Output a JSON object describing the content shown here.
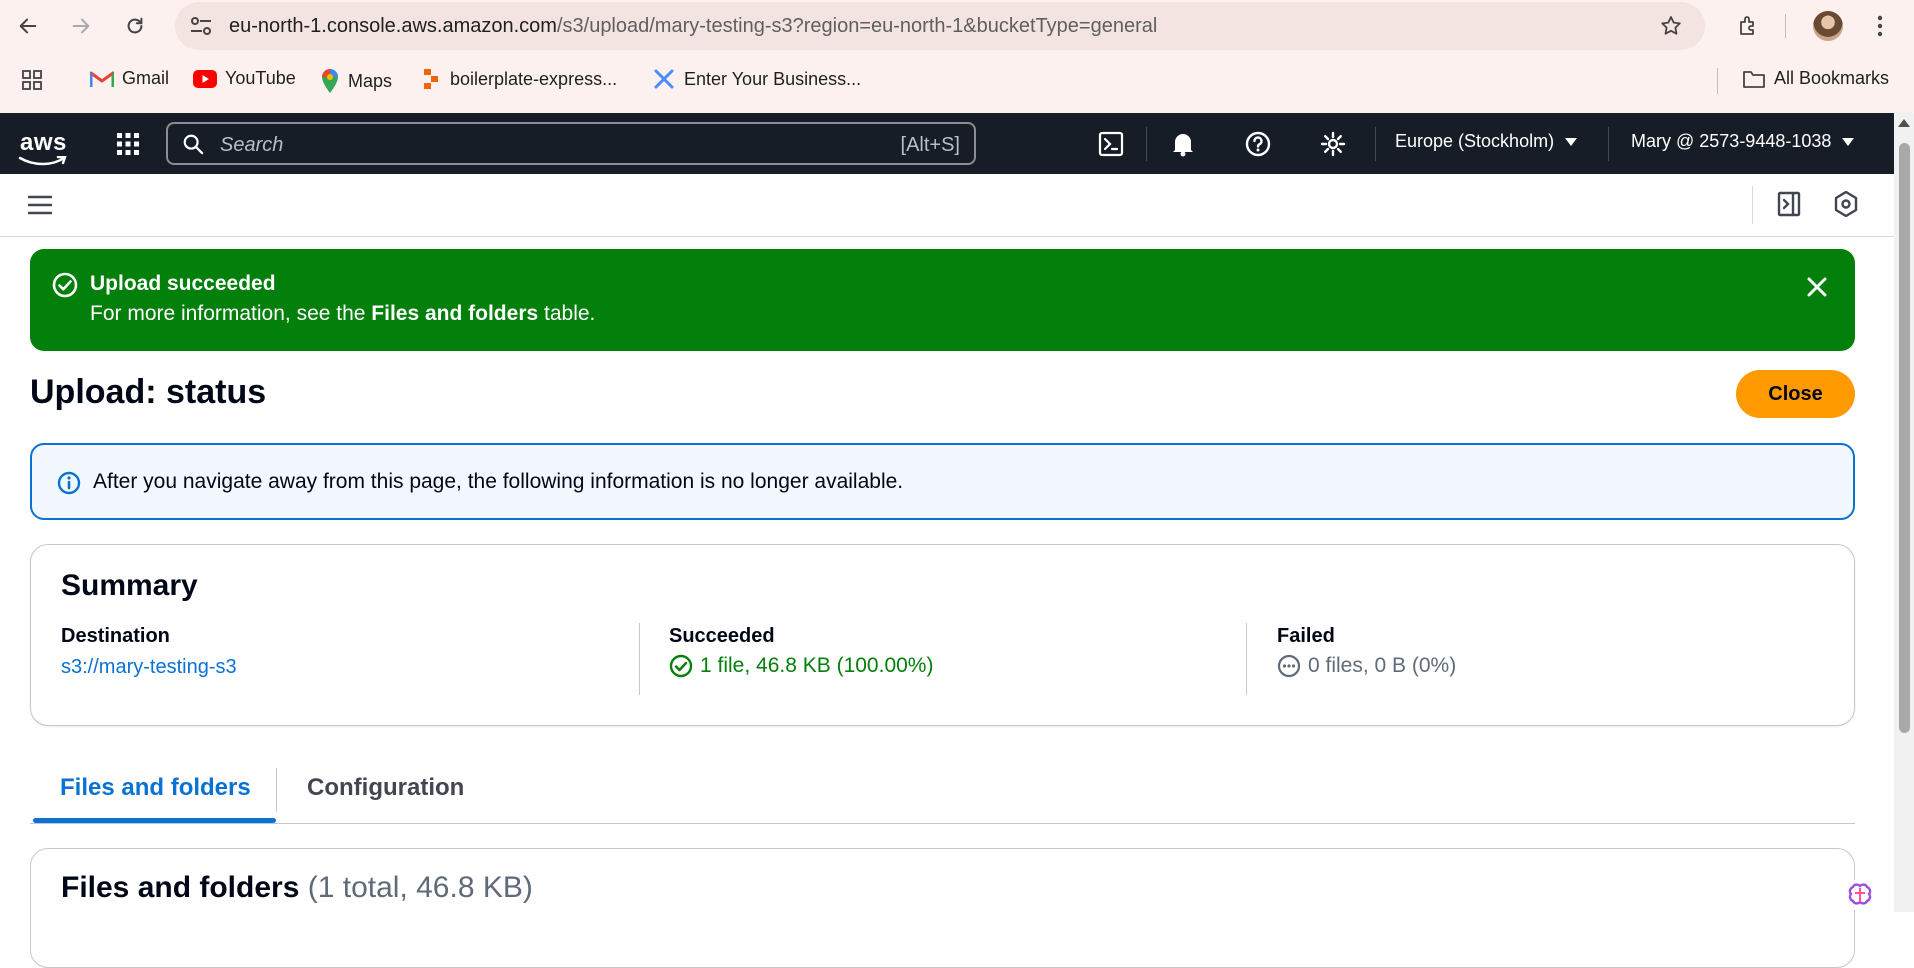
{
  "browser": {
    "url_domain": "eu-north-1.console.aws.amazon.com",
    "url_path": "/s3/upload/mary-testing-s3?region=eu-north-1&bucketType=general",
    "bookmarks": [
      {
        "label": "Gmail",
        "icon": "gmail-icon"
      },
      {
        "label": "YouTube",
        "icon": "youtube-icon"
      },
      {
        "label": "Maps",
        "icon": "maps-icon"
      },
      {
        "label": "boilerplate-express...",
        "icon": "replit-icon"
      },
      {
        "label": "Enter Your Business...",
        "icon": "app-icon"
      }
    ],
    "all_bookmarks": "All Bookmarks"
  },
  "aws_nav": {
    "logo": "aws",
    "search_placeholder": "Search",
    "search_shortcut": "[Alt+S]",
    "region": "Europe (Stockholm)",
    "account": "Mary @ 2573-9448-1038"
  },
  "flash": {
    "title": "Upload succeeded",
    "message_prefix": "For more information, see the ",
    "message_bold": "Files and folders",
    "message_suffix": " table.",
    "color": "#037f0c"
  },
  "header": {
    "title": "Upload: status",
    "close_label": "Close"
  },
  "info_alert": {
    "text": "After you navigate away from this page, the following information is no longer available."
  },
  "summary": {
    "title": "Summary",
    "destination_label": "Destination",
    "destination_value": "s3://mary-testing-s3",
    "succeeded_label": "Succeeded",
    "succeeded_value": "1 file, 46.8 KB (100.00%)",
    "failed_label": "Failed",
    "failed_value": "0 files, 0 B (0%)"
  },
  "tabs": [
    {
      "label": "Files and folders",
      "active": true
    },
    {
      "label": "Configuration",
      "active": false
    }
  ],
  "files_panel": {
    "title": "Files and folders",
    "count": "(1 total, 46.8 KB)"
  },
  "colors": {
    "accent": "#0972d3",
    "success": "#037f0c",
    "primary_button": "#ff9900",
    "nav_bg": "#161d26"
  }
}
